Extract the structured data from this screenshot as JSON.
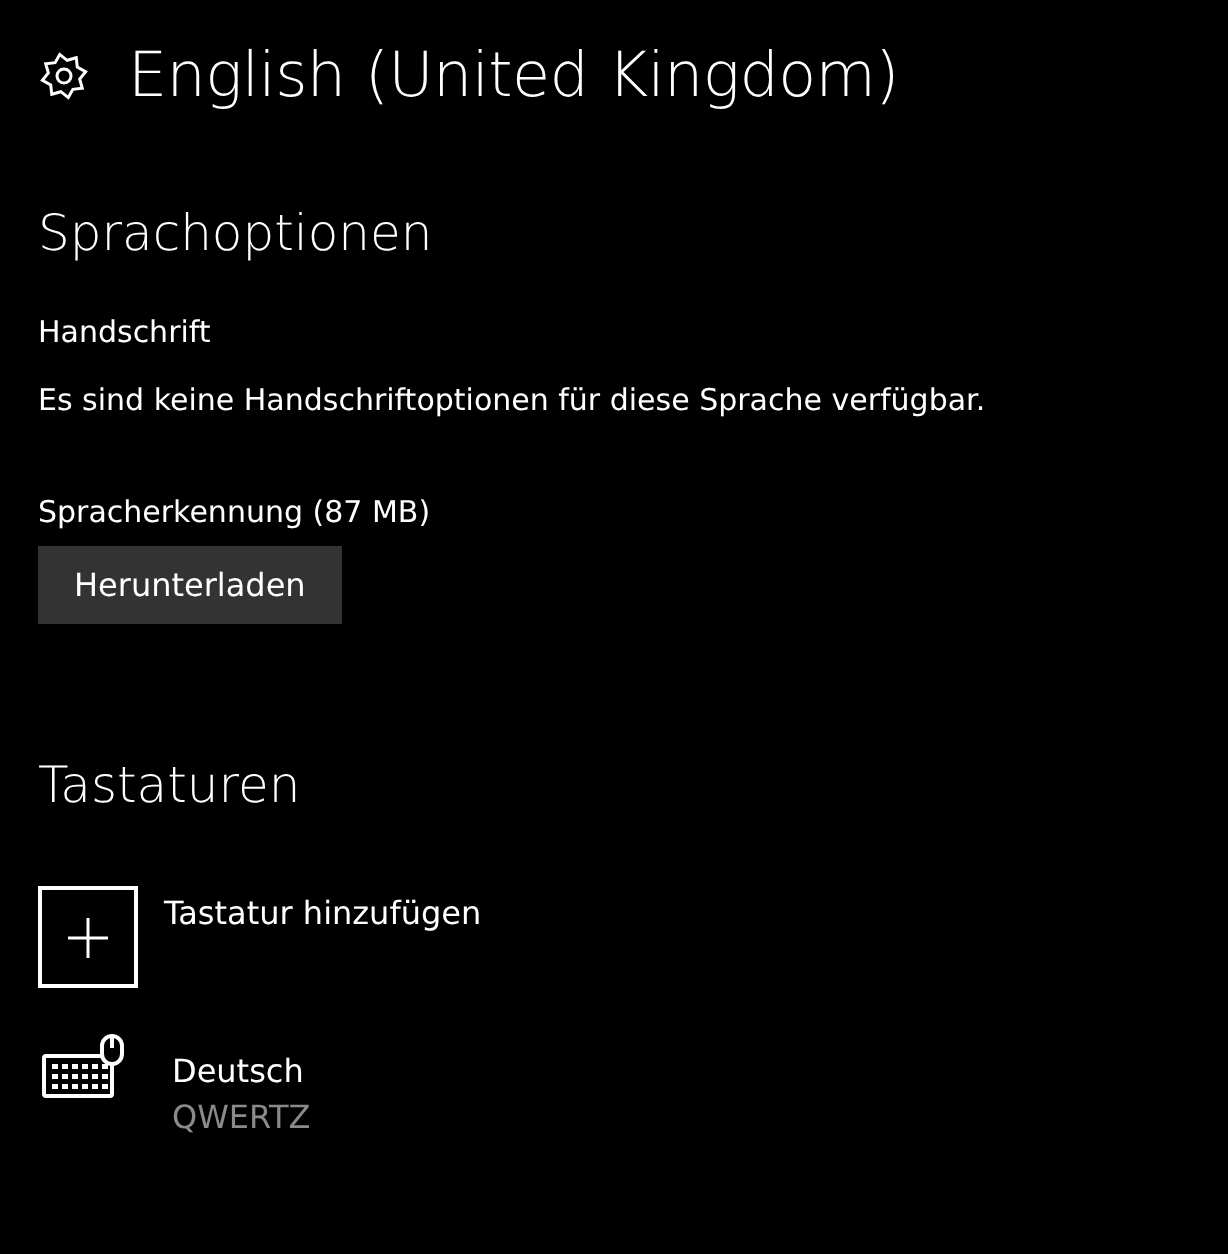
{
  "title": "English (United Kingdom)",
  "language_options": {
    "heading": "Sprachoptionen",
    "handwriting": {
      "label": "Handschrift",
      "text": "Es sind keine Handschriftoptionen für diese Sprache verfügbar."
    },
    "speech": {
      "label": "Spracherkennung (87 MB)",
      "button": "Herunterladen"
    }
  },
  "keyboards": {
    "heading": "Tastaturen",
    "items": [
      {
        "kind": "add",
        "label": "Tastatur hinzufügen"
      },
      {
        "kind": "keyboard",
        "label": "Deutsch",
        "sublabel": "QWERTZ"
      }
    ]
  }
}
